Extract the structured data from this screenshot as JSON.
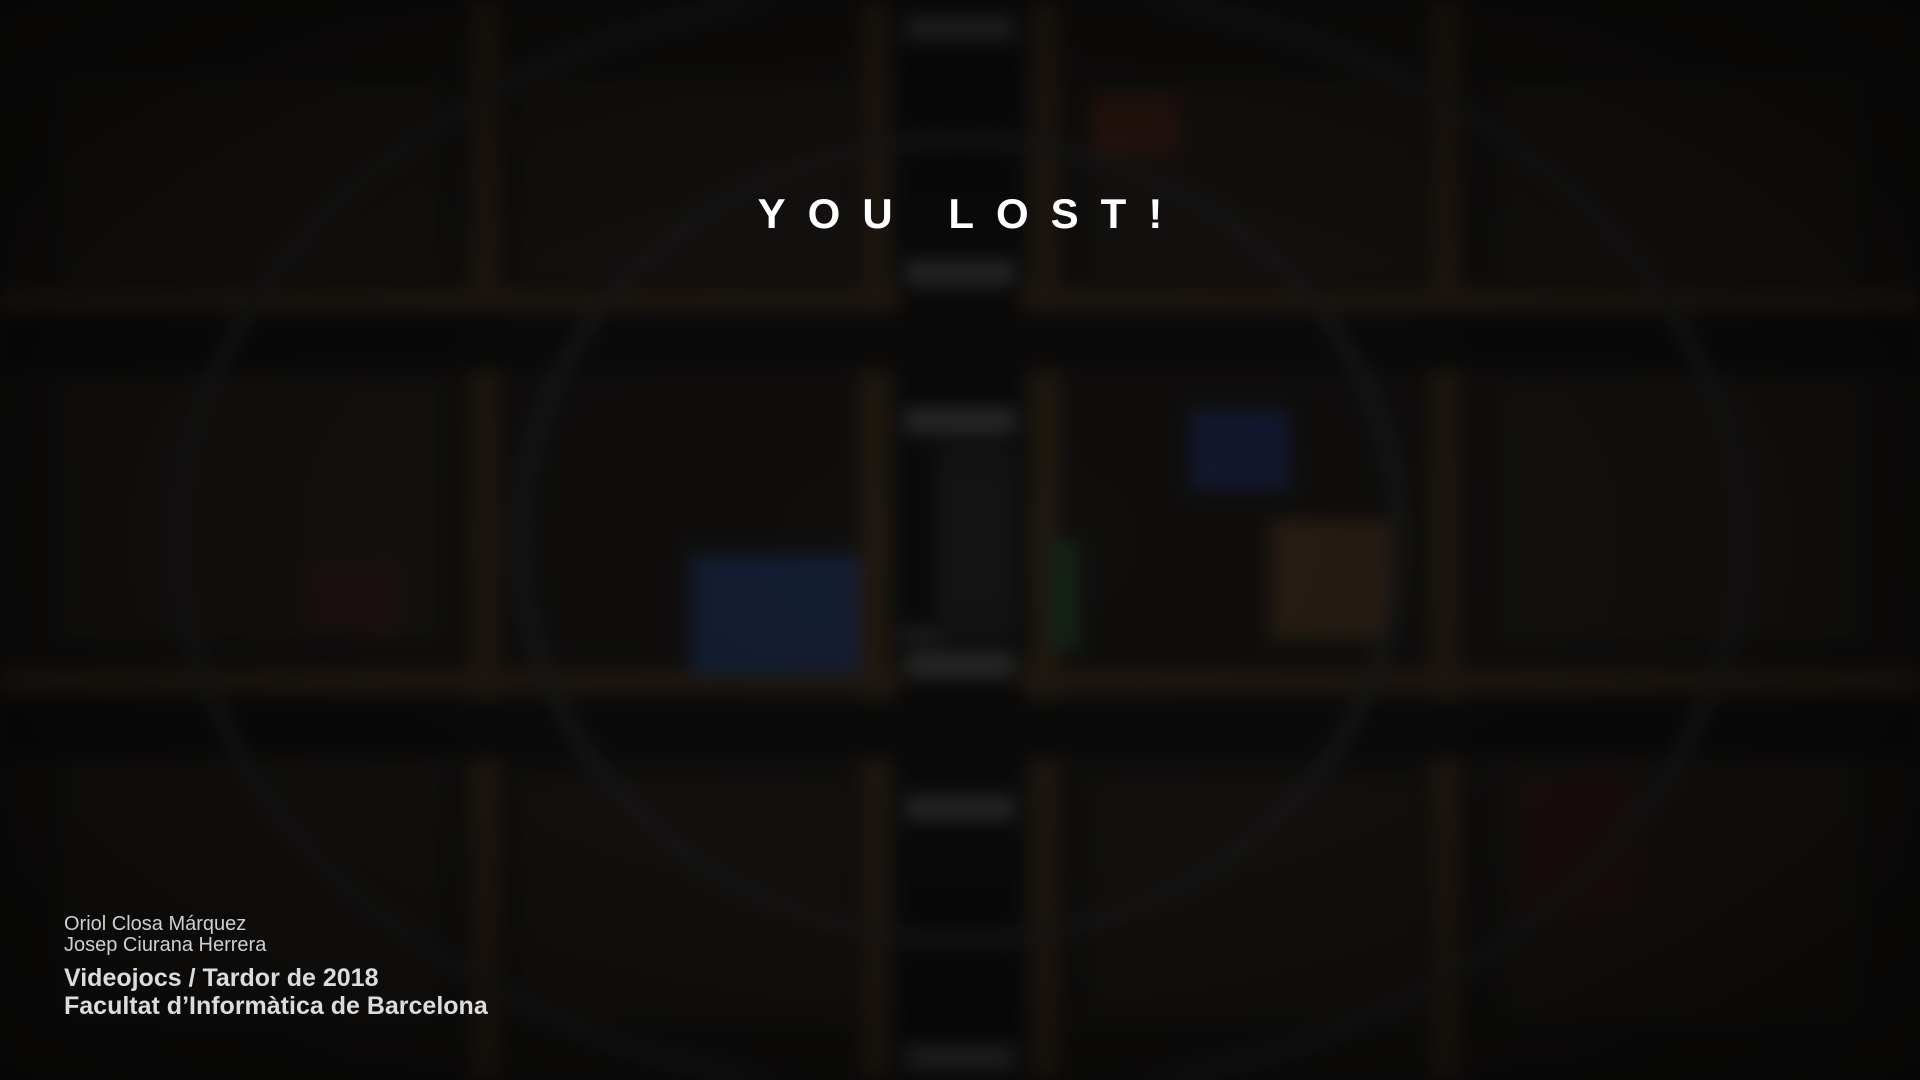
{
  "screen": {
    "title": "YOU LOST!"
  },
  "credits": {
    "authors": [
      "Oriol Closa Márquez",
      "Josep Ciurana Herrera"
    ],
    "course": "Videojocs / Tardor de 2018",
    "faculty": "Facultat d’Informàtica de Barcelona"
  },
  "colors": {
    "background": "#111010",
    "road": "#0a0a0a",
    "sidewalk": "#3a2a18",
    "text": "#ffffff",
    "credits_text": "#d9d9d9"
  }
}
